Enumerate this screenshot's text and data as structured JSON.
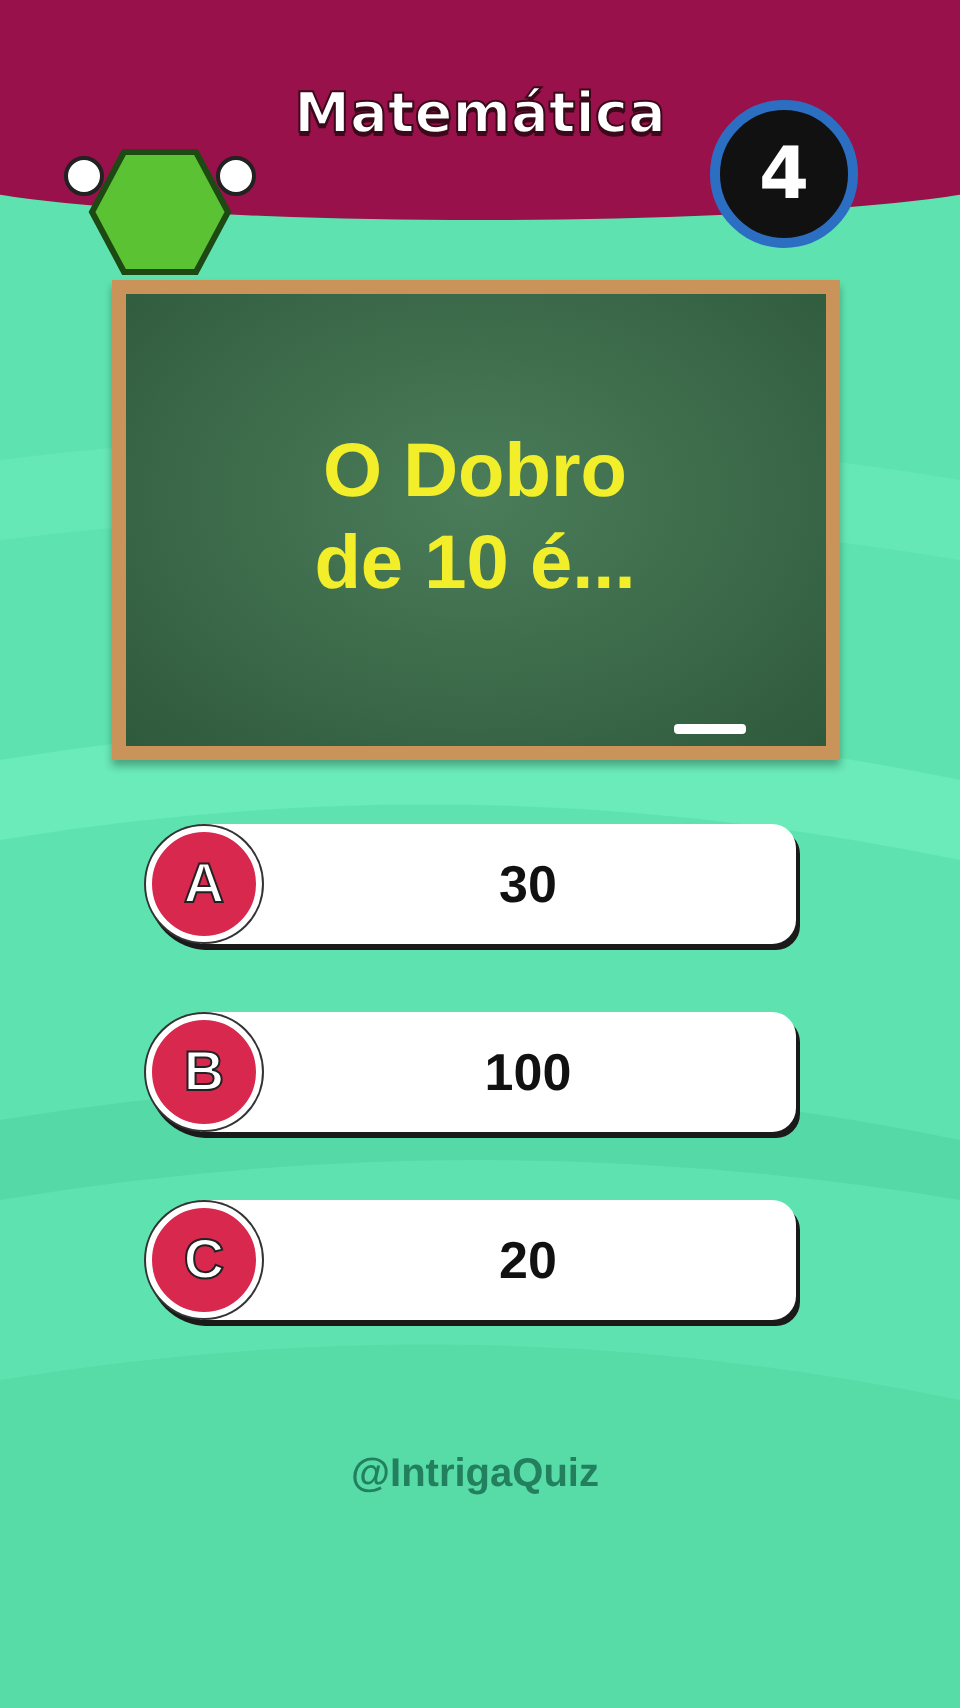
{
  "header": {
    "title": "Matemática",
    "question_number": "4"
  },
  "question": {
    "text": "O Dobro de 10 é..."
  },
  "answers": [
    {
      "letter": "A",
      "text": "30"
    },
    {
      "letter": "B",
      "text": "100"
    },
    {
      "letter": "C",
      "text": "20"
    }
  ],
  "handle": "@IntrigaQuiz"
}
